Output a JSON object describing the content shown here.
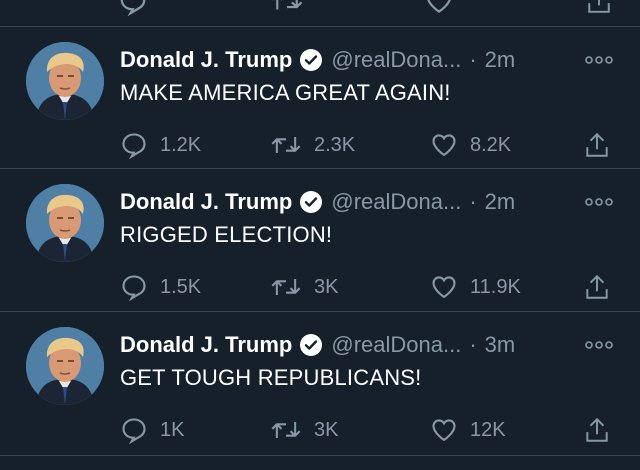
{
  "tweets": [
    {
      "name": "Donald J. Trump",
      "handle": "@realDona...",
      "separator": "·",
      "time": "2m",
      "text": "MAKE AMERICA GREAT AGAIN!",
      "replies": "1.2K",
      "retweets": "2.3K",
      "likes": "8.2K",
      "verified_icon": "verified-badge-icon"
    },
    {
      "name": "Donald J. Trump",
      "handle": "@realDona...",
      "separator": "·",
      "time": "2m",
      "text": "RIGGED ELECTION!",
      "replies": "1.5K",
      "retweets": "3K",
      "likes": "11.9K",
      "verified_icon": "verified-badge-icon"
    },
    {
      "name": "Donald J. Trump",
      "handle": "@realDona...",
      "separator": "·",
      "time": "3m",
      "text": "GET TOUGH REPUBLICANS!",
      "replies": "1K",
      "retweets": "3K",
      "likes": "12K",
      "verified_icon": "verified-badge-icon"
    }
  ],
  "colors": {
    "background": "#15202b",
    "divider": "#38444d",
    "secondary_text": "#8899a6",
    "verified": "#ffffff"
  }
}
